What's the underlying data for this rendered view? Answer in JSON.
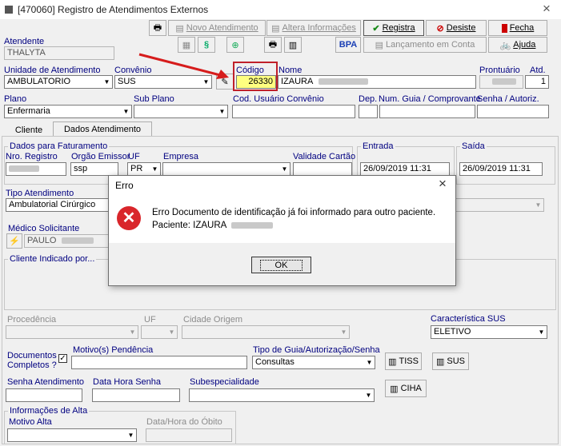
{
  "window": {
    "title": "[470060]  Registro de Atendimentos Externos",
    "close_glyph": "×"
  },
  "toolbar": {
    "novo": "Novo Atendimento",
    "altera": "Altera Informações",
    "registra": "Registra",
    "desiste": "Desiste",
    "fecha": "Fecha",
    "ajuda": "Ajuda",
    "bpa": "BPA",
    "lancamento": "Lançamento em Conta"
  },
  "header": {
    "atendente_label": "Atendente",
    "atendente_value": "THALYTA",
    "unidade_label": "Unidade de Atendimento",
    "unidade_value": "AMBULATORIO",
    "convenio_label": "Convênio",
    "convenio_value": "SUS",
    "codigo_label": "Código",
    "codigo_value": "26330",
    "nome_label": "Nome",
    "nome_value": "IZAURA",
    "prontuario_label": "Prontuário",
    "atd_label": "Atd.",
    "atd_value": "1",
    "plano_label": "Plano",
    "plano_value": "Enfermaria",
    "subplano_label": "Sub Plano",
    "cod_usuario_label": "Cod. Usuário Convênio",
    "dep_label": "Dep.",
    "num_guia_label": "Num. Guia / Comprovante",
    "senha_label": "Senha / Autoriz."
  },
  "tabs": {
    "cliente": "Cliente",
    "dados": "Dados Atendimento"
  },
  "faturamento": {
    "group": "Dados para Faturamento",
    "nro_label": "Nro. Registro",
    "orgao_label": "Orgão Emissor",
    "orgao_value": "ssp",
    "uf_label": "UF",
    "uf_value": "PR",
    "empresa_label": "Empresa",
    "validade_label": "Validade Cartão"
  },
  "entrada": {
    "label": "Entrada",
    "value": "26/09/2019  11:31"
  },
  "saida": {
    "label": "Saída",
    "value": "26/09/2019  11:31"
  },
  "tipo": {
    "label": "Tipo Atendimento",
    "value": "Ambulatorial Cirúrgico"
  },
  "medico": {
    "label": "Médico Solicitante",
    "value": "PAULO"
  },
  "cliente_indicado": {
    "label": "Cliente Indicado por..."
  },
  "procedencia": {
    "proc_label": "Procedência",
    "uf_label": "UF",
    "cidade_label": "Cidade Origem"
  },
  "sus": {
    "label": "Característica SUS",
    "value": "ELETIVO"
  },
  "docs": {
    "documentos_label": "Documentos Completos ?",
    "motivo_label": "Motivo(s) Pendência",
    "tipo_guia_label": "Tipo de Guia/Autorização/Senha",
    "tipo_guia_value": "Consultas",
    "tiss": "TISS",
    "sus_btn": "SUS",
    "ciha": "CIHA"
  },
  "senha_row": {
    "senha_atend_label": "Senha Atendimento",
    "data_hora_label": "Data Hora Senha",
    "subespecialidade_label": "Subespecialidade"
  },
  "alta": {
    "group": "Informações de Alta",
    "motivo_label": "Motivo Alta",
    "obito_label": "Data/Hora do Óbito"
  },
  "dialog": {
    "title": "Erro",
    "message": "Erro Documento de identificação já foi informado para outro paciente.",
    "paciente": "Paciente: IZAURA",
    "ok": "OK",
    "close_glyph": "×"
  }
}
